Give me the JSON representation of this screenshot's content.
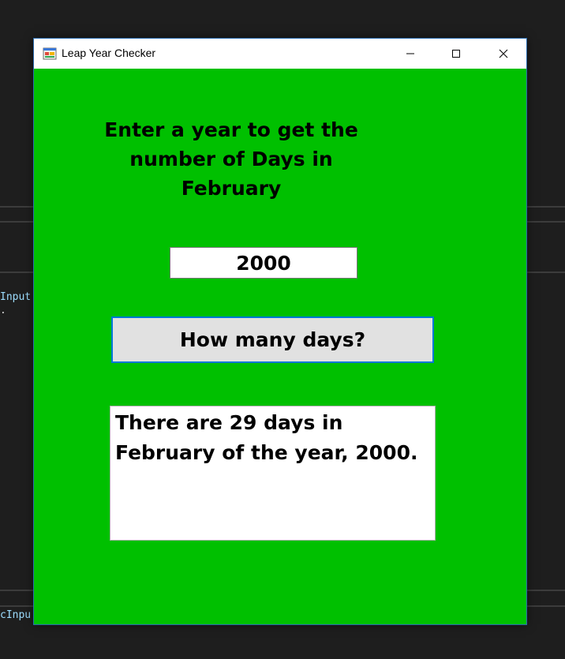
{
  "background": {
    "code_snippet_1": "Input",
    "code_snippet_2": ".",
    "code_snippet_3": "cInpu"
  },
  "window": {
    "title": "Leap Year Checker",
    "icon": "app-window-icon",
    "controls": {
      "minimize_icon": "minimize-icon",
      "maximize_icon": "maximize-icon",
      "close_icon": "close-icon"
    }
  },
  "form": {
    "prompt": "Enter a year to get the number of Days in February",
    "year_value": "2000",
    "button_label": "How many days?",
    "result_text": "There are 29 days in February of the year, 2000."
  },
  "colors": {
    "form_background": "#00c000",
    "button_border": "#0078d7",
    "button_background": "#e1e1e1"
  }
}
